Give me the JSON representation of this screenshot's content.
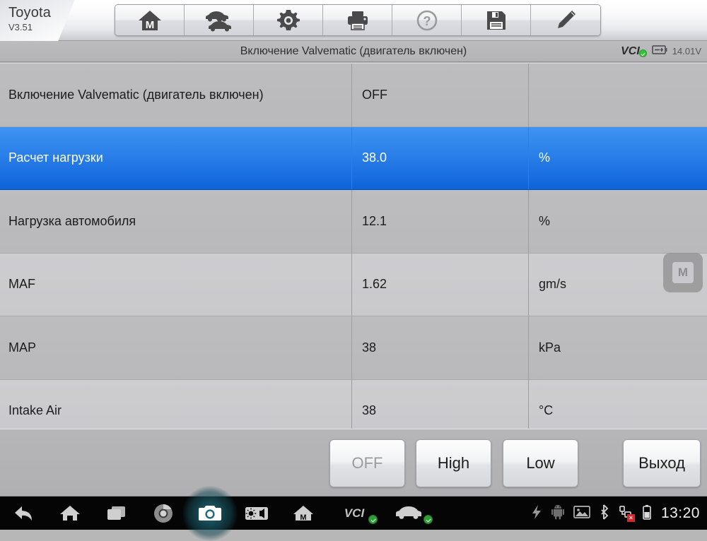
{
  "brand": {
    "name": "Toyota",
    "version": "V3.51"
  },
  "toolbar": {
    "buttons": [
      {
        "name": "home-m-button",
        "icon": "home-m-icon"
      },
      {
        "name": "vehicle-swap-button",
        "icon": "car-swap-icon"
      },
      {
        "name": "settings-button",
        "icon": "gear-icon"
      },
      {
        "name": "print-button",
        "icon": "printer-icon"
      },
      {
        "name": "help-button",
        "icon": "question-circle-icon"
      },
      {
        "name": "save-button",
        "icon": "floppy-disk-icon"
      },
      {
        "name": "edit-button",
        "icon": "pencil-icon"
      }
    ]
  },
  "titlebar": {
    "title": "Включение Valvematic (двигатель включен)",
    "vci_label": "VCI",
    "voltage": "14.01V"
  },
  "table": {
    "rows": [
      {
        "name": "Включение Valvematic (двигатель включен)",
        "value": "OFF",
        "unit": "",
        "selected": false
      },
      {
        "name": "Расчет нагрузки",
        "value": "38.0",
        "unit": "%",
        "selected": true
      },
      {
        "name": "Нагрузка автомобиля",
        "value": "12.1",
        "unit": "%",
        "selected": false
      },
      {
        "name": "MAF",
        "value": "1.62",
        "unit": "gm/s",
        "selected": false
      },
      {
        "name": "MAP",
        "value": "38",
        "unit": "kPa",
        "selected": false
      },
      {
        "name": "Intake Air",
        "value": "38",
        "unit": "°C",
        "selected": false
      }
    ]
  },
  "floating_button": {
    "label": "M"
  },
  "action_buttons": [
    {
      "label": "OFF",
      "name": "off-button",
      "disabled": true
    },
    {
      "label": "High",
      "name": "high-button",
      "disabled": false
    },
    {
      "label": "Low",
      "name": "low-button",
      "disabled": false
    },
    {
      "label": "Выход",
      "name": "exit-button",
      "disabled": false
    }
  ],
  "navbar": {
    "items": [
      {
        "name": "nav-back-button",
        "icon": "back-arrow-icon"
      },
      {
        "name": "nav-home-button",
        "icon": "home-icon"
      },
      {
        "name": "nav-recents-button",
        "icon": "recents-icon"
      },
      {
        "name": "nav-chrome-button",
        "icon": "chrome-icon"
      },
      {
        "name": "nav-camera-button",
        "icon": "camera-icon"
      },
      {
        "name": "nav-display-button",
        "icon": "brightness-volume-icon"
      },
      {
        "name": "nav-diagnostic-home-button",
        "icon": "home-m-icon"
      },
      {
        "name": "nav-vci-status",
        "icon": "vci-check-icon",
        "label": "VCI"
      },
      {
        "name": "nav-vehicle-status",
        "icon": "car-check-icon"
      }
    ],
    "system": {
      "icons": [
        "lightning-icon",
        "android-robot-icon",
        "gallery-icon",
        "bluetooth-icon",
        "network-disconnected-icon",
        "battery-icon"
      ],
      "clock": "13:20"
    }
  },
  "colors": {
    "selection_blue": "#2a7fe9",
    "status_green": "#2f9e35",
    "row_dark": "#bdbdbf",
    "row_light": "#cdcdd0"
  }
}
